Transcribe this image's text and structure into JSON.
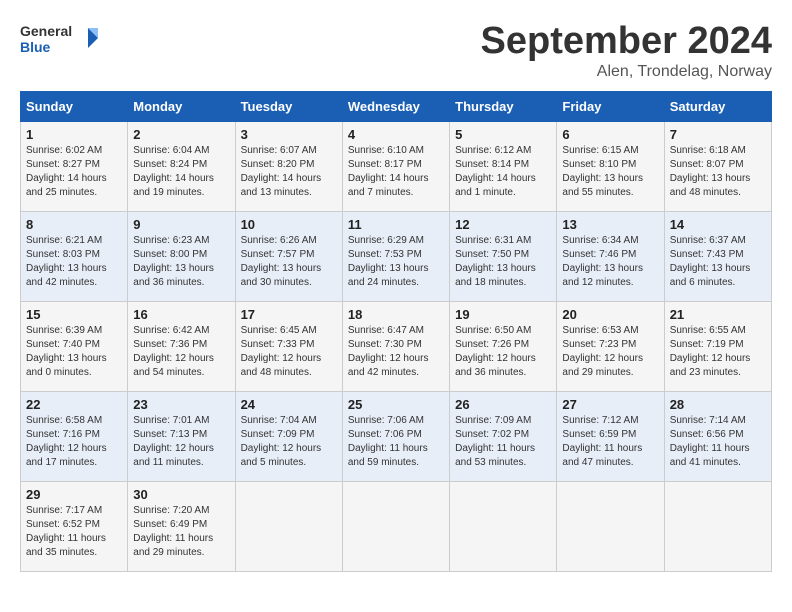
{
  "header": {
    "logo_text_general": "General",
    "logo_text_blue": "Blue",
    "month_title": "September 2024",
    "subtitle": "Alen, Trondelag, Norway"
  },
  "weekdays": [
    "Sunday",
    "Monday",
    "Tuesday",
    "Wednesday",
    "Thursday",
    "Friday",
    "Saturday"
  ],
  "weeks": [
    [
      {
        "day": "1",
        "info": "Sunrise: 6:02 AM\nSunset: 8:27 PM\nDaylight: 14 hours\nand 25 minutes."
      },
      {
        "day": "2",
        "info": "Sunrise: 6:04 AM\nSunset: 8:24 PM\nDaylight: 14 hours\nand 19 minutes."
      },
      {
        "day": "3",
        "info": "Sunrise: 6:07 AM\nSunset: 8:20 PM\nDaylight: 14 hours\nand 13 minutes."
      },
      {
        "day": "4",
        "info": "Sunrise: 6:10 AM\nSunset: 8:17 PM\nDaylight: 14 hours\nand 7 minutes."
      },
      {
        "day": "5",
        "info": "Sunrise: 6:12 AM\nSunset: 8:14 PM\nDaylight: 14 hours\nand 1 minute."
      },
      {
        "day": "6",
        "info": "Sunrise: 6:15 AM\nSunset: 8:10 PM\nDaylight: 13 hours\nand 55 minutes."
      },
      {
        "day": "7",
        "info": "Sunrise: 6:18 AM\nSunset: 8:07 PM\nDaylight: 13 hours\nand 48 minutes."
      }
    ],
    [
      {
        "day": "8",
        "info": "Sunrise: 6:21 AM\nSunset: 8:03 PM\nDaylight: 13 hours\nand 42 minutes."
      },
      {
        "day": "9",
        "info": "Sunrise: 6:23 AM\nSunset: 8:00 PM\nDaylight: 13 hours\nand 36 minutes."
      },
      {
        "day": "10",
        "info": "Sunrise: 6:26 AM\nSunset: 7:57 PM\nDaylight: 13 hours\nand 30 minutes."
      },
      {
        "day": "11",
        "info": "Sunrise: 6:29 AM\nSunset: 7:53 PM\nDaylight: 13 hours\nand 24 minutes."
      },
      {
        "day": "12",
        "info": "Sunrise: 6:31 AM\nSunset: 7:50 PM\nDaylight: 13 hours\nand 18 minutes."
      },
      {
        "day": "13",
        "info": "Sunrise: 6:34 AM\nSunset: 7:46 PM\nDaylight: 13 hours\nand 12 minutes."
      },
      {
        "day": "14",
        "info": "Sunrise: 6:37 AM\nSunset: 7:43 PM\nDaylight: 13 hours\nand 6 minutes."
      }
    ],
    [
      {
        "day": "15",
        "info": "Sunrise: 6:39 AM\nSunset: 7:40 PM\nDaylight: 13 hours\nand 0 minutes."
      },
      {
        "day": "16",
        "info": "Sunrise: 6:42 AM\nSunset: 7:36 PM\nDaylight: 12 hours\nand 54 minutes."
      },
      {
        "day": "17",
        "info": "Sunrise: 6:45 AM\nSunset: 7:33 PM\nDaylight: 12 hours\nand 48 minutes."
      },
      {
        "day": "18",
        "info": "Sunrise: 6:47 AM\nSunset: 7:30 PM\nDaylight: 12 hours\nand 42 minutes."
      },
      {
        "day": "19",
        "info": "Sunrise: 6:50 AM\nSunset: 7:26 PM\nDaylight: 12 hours\nand 36 minutes."
      },
      {
        "day": "20",
        "info": "Sunrise: 6:53 AM\nSunset: 7:23 PM\nDaylight: 12 hours\nand 29 minutes."
      },
      {
        "day": "21",
        "info": "Sunrise: 6:55 AM\nSunset: 7:19 PM\nDaylight: 12 hours\nand 23 minutes."
      }
    ],
    [
      {
        "day": "22",
        "info": "Sunrise: 6:58 AM\nSunset: 7:16 PM\nDaylight: 12 hours\nand 17 minutes."
      },
      {
        "day": "23",
        "info": "Sunrise: 7:01 AM\nSunset: 7:13 PM\nDaylight: 12 hours\nand 11 minutes."
      },
      {
        "day": "24",
        "info": "Sunrise: 7:04 AM\nSunset: 7:09 PM\nDaylight: 12 hours\nand 5 minutes."
      },
      {
        "day": "25",
        "info": "Sunrise: 7:06 AM\nSunset: 7:06 PM\nDaylight: 11 hours\nand 59 minutes."
      },
      {
        "day": "26",
        "info": "Sunrise: 7:09 AM\nSunset: 7:02 PM\nDaylight: 11 hours\nand 53 minutes."
      },
      {
        "day": "27",
        "info": "Sunrise: 7:12 AM\nSunset: 6:59 PM\nDaylight: 11 hours\nand 47 minutes."
      },
      {
        "day": "28",
        "info": "Sunrise: 7:14 AM\nSunset: 6:56 PM\nDaylight: 11 hours\nand 41 minutes."
      }
    ],
    [
      {
        "day": "29",
        "info": "Sunrise: 7:17 AM\nSunset: 6:52 PM\nDaylight: 11 hours\nand 35 minutes."
      },
      {
        "day": "30",
        "info": "Sunrise: 7:20 AM\nSunset: 6:49 PM\nDaylight: 11 hours\nand 29 minutes."
      },
      null,
      null,
      null,
      null,
      null
    ]
  ]
}
